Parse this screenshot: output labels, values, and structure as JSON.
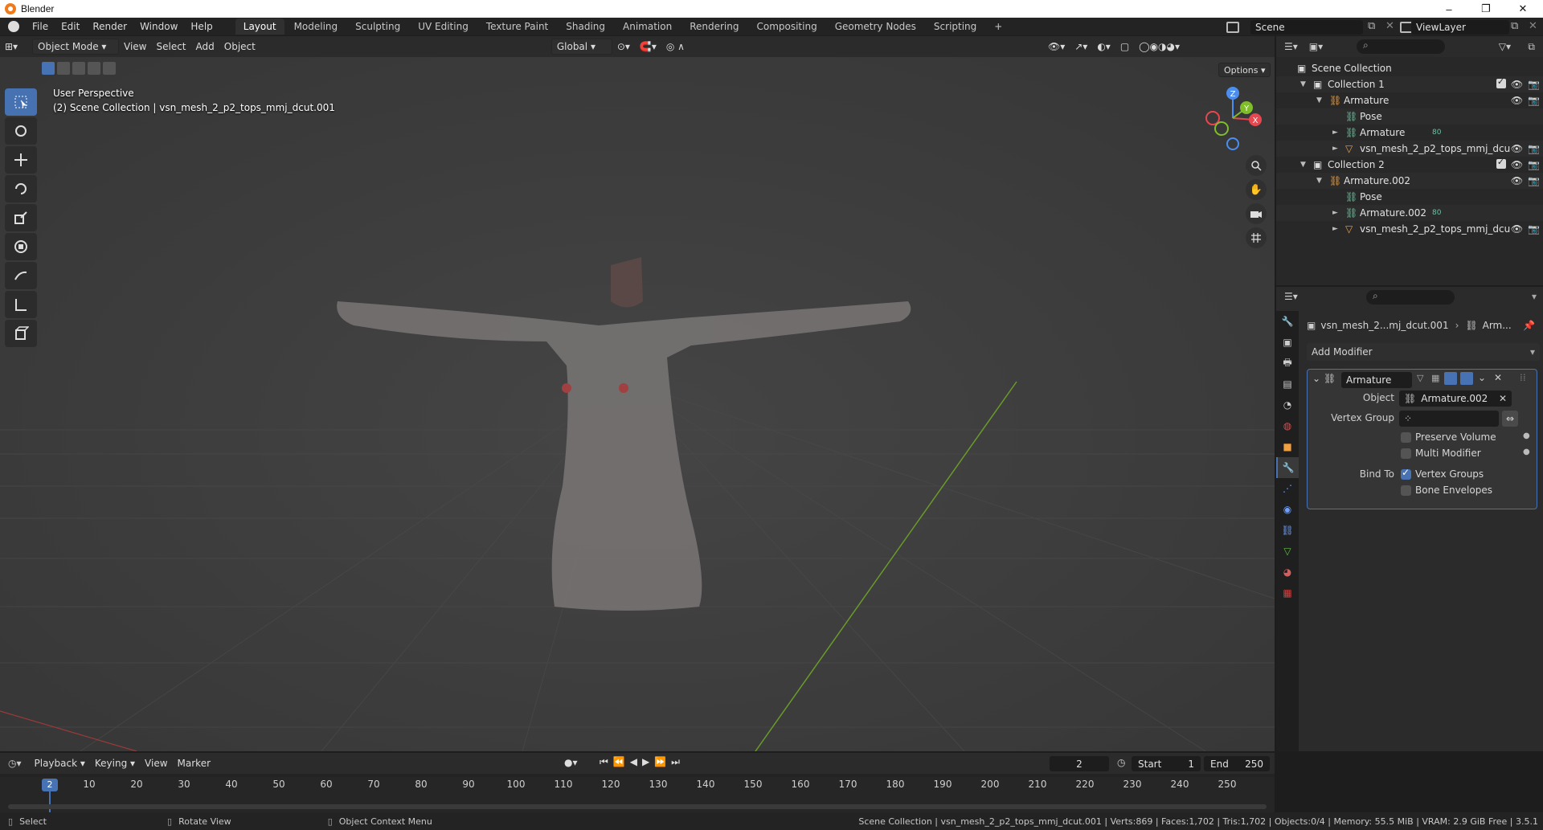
{
  "window": {
    "title": "Blender",
    "controls": [
      "–",
      "❐",
      "✕"
    ]
  },
  "menu": [
    "File",
    "Edit",
    "Render",
    "Window",
    "Help"
  ],
  "workspaces": [
    "Layout",
    "Modeling",
    "Sculpting",
    "UV Editing",
    "Texture Paint",
    "Shading",
    "Animation",
    "Rendering",
    "Compositing",
    "Geometry Nodes",
    "Scripting",
    "+"
  ],
  "active_workspace": "Layout",
  "scene": {
    "name": "Scene",
    "view_layer": "ViewLayer"
  },
  "viewport": {
    "mode": "Object Mode",
    "menus": [
      "View",
      "Select",
      "Add",
      "Object"
    ],
    "orientation": "Global",
    "options_label": "Options",
    "overlay_title": "User Perspective",
    "overlay_subtitle": "(2) Scene Collection | vsn_mesh_2_p2_tops_mmj_dcut.001",
    "axes": {
      "x": "X",
      "y": "Y",
      "z": "Z"
    }
  },
  "outliner": {
    "rows": [
      {
        "label": "Scene Collection",
        "indent": 0,
        "icon": "collection-icon",
        "expander": ""
      },
      {
        "label": "Collection 1",
        "indent": 1,
        "icon": "collection-icon",
        "expander": "▼"
      },
      {
        "label": "Armature",
        "indent": 2,
        "icon": "armature-icon",
        "expander": "▼"
      },
      {
        "label": "Pose",
        "indent": 3,
        "icon": "pose-icon",
        "expander": ""
      },
      {
        "label": "Armature",
        "indent": 3,
        "icon": "armature-data-icon",
        "expander": "►",
        "badge": "80"
      },
      {
        "label": "vsn_mesh_2_p2_tops_mmj_dcu",
        "indent": 3,
        "icon": "mesh-icon",
        "expander": "►"
      },
      {
        "label": "Collection 2",
        "indent": 1,
        "icon": "collection-icon",
        "expander": "▼"
      },
      {
        "label": "Armature.002",
        "indent": 2,
        "icon": "armature-icon",
        "expander": "▼"
      },
      {
        "label": "Pose",
        "indent": 3,
        "icon": "pose-icon",
        "expander": ""
      },
      {
        "label": "Armature.002",
        "indent": 3,
        "icon": "armature-data-icon",
        "expander": "►",
        "badge": "80"
      },
      {
        "label": "vsn_mesh_2_p2_tops_mmj_dcu",
        "indent": 3,
        "icon": "mesh-icon",
        "expander": "►"
      }
    ]
  },
  "properties": {
    "breadcrumb_object": "vsn_mesh_2...mj_dcut.001",
    "breadcrumb_modifier": "Arm...",
    "add_modifier": "Add Modifier",
    "modifier": {
      "name": "Armature",
      "object_label": "Object",
      "object_value": "Armature.002",
      "vertex_group_label": "Vertex Group",
      "vertex_group_value": "",
      "preserve_volume": {
        "label": "Preserve Volume",
        "checked": false
      },
      "multi_modifier": {
        "label": "Multi Modifier",
        "checked": false
      },
      "bind_to_label": "Bind To",
      "vertex_groups": {
        "label": "Vertex Groups",
        "checked": true
      },
      "bone_envelopes": {
        "label": "Bone Envelopes",
        "checked": false
      }
    }
  },
  "timeline": {
    "menus": [
      "Playback",
      "Keying",
      "View",
      "Marker"
    ],
    "current_frame": "2",
    "start_label": "Start",
    "start_value": "1",
    "end_label": "End",
    "end_value": "250",
    "ruler": [
      "10",
      "20",
      "30",
      "40",
      "50",
      "60",
      "70",
      "80",
      "90",
      "100",
      "110",
      "120",
      "130",
      "140",
      "150",
      "160",
      "170",
      "180",
      "190",
      "200",
      "210",
      "220",
      "230",
      "240",
      "250"
    ]
  },
  "status": {
    "hint_select": "Select",
    "hint_rotate": "Rotate View",
    "hint_context": "Object Context Menu",
    "info": "Scene Collection | vsn_mesh_2_p2_tops_mmj_dcut.001 | Verts:869 | Faces:1,702 | Tris:1,702 | Objects:0/4 | Memory: 55.5 MiB | VRAM: 2.9 GiB Free | 3.5.1"
  },
  "colors": {
    "accent": "#4772b3",
    "x_axis": "#e8474f",
    "y_axis": "#80bd2b",
    "z_axis": "#4b8ef0"
  }
}
